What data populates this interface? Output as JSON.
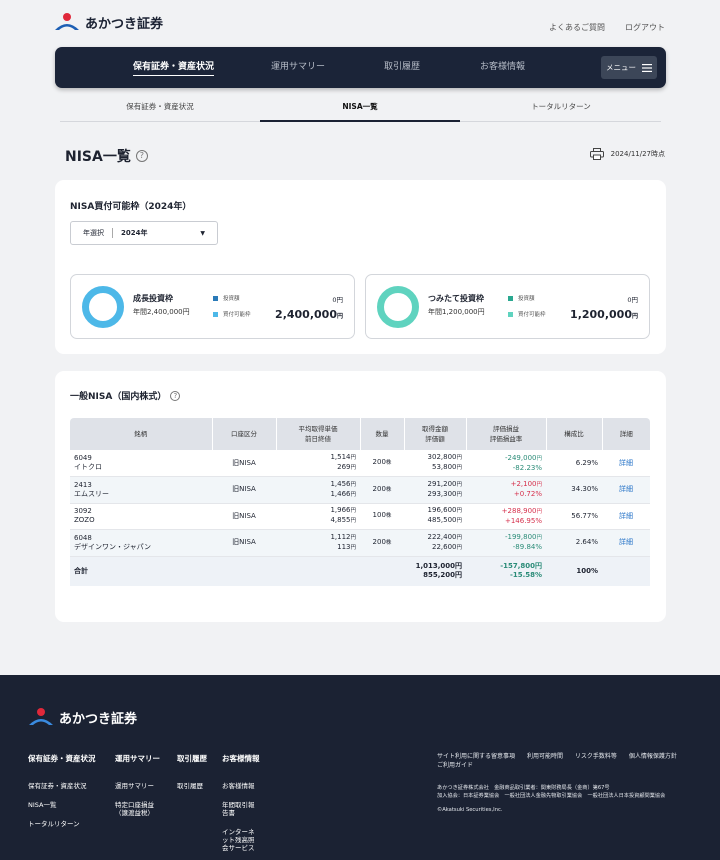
{
  "brand": {
    "name": "あかつき証券"
  },
  "top_links": [
    "よくあるご質問",
    "ログアウト"
  ],
  "nav": {
    "items": [
      "保有証券・資産状況",
      "運用サマリー",
      "取引履歴",
      "お客様情報"
    ],
    "menu_label": "メニュー"
  },
  "subtabs": [
    "保有証券・資産状況",
    "NISA一覧",
    "トータルリターン"
  ],
  "page": {
    "title": "NISA一覧",
    "date": "2024/11/27時点"
  },
  "limits": {
    "title": "NISA買付可能枠（2024年）",
    "year_label": "年選択",
    "year_value": "2024年",
    "legend_invested": "投資額",
    "legend_available": "買付可能枠",
    "boxes": [
      {
        "name": "成長投資枠",
        "annual": "年間2,400,000円",
        "invested": "0",
        "available": "2,400,000",
        "color": "#4db8e8",
        "unit": "円"
      },
      {
        "name": "つみたて投資枠",
        "annual": "年間1,200,000円",
        "invested": "0",
        "available": "1,200,000",
        "color": "#5fd3bf",
        "unit": "円"
      }
    ]
  },
  "holdings": {
    "title": "一般NISA（国内株式）",
    "columns": {
      "name": "銘柄",
      "account": "口座区分",
      "avg1": "平均取得単価",
      "avg2": "前日終値",
      "qty": "数量",
      "amt1": "取得金額",
      "amt2": "評価額",
      "pl1": "評価損益",
      "pl2": "評価損益率",
      "ratio": "構成比",
      "detail": "詳細"
    },
    "rows": [
      {
        "code": "6049",
        "name": "イトクロ",
        "account": "旧NISA",
        "avg": "1,514",
        "close": "269",
        "qty": "200",
        "cost": "302,800",
        "value": "53,800",
        "pl": "-249,000",
        "pl_rate": "-82.23%",
        "ratio": "6.29%",
        "detail": "詳細",
        "sign": "neg"
      },
      {
        "code": "2413",
        "name": "エムスリー",
        "account": "旧NISA",
        "avg": "1,456",
        "close": "1,466",
        "qty": "200",
        "cost": "291,200",
        "value": "293,300",
        "pl": "+2,100",
        "pl_rate": "+0.72%",
        "ratio": "34.30%",
        "detail": "詳細",
        "sign": "pos"
      },
      {
        "code": "3092",
        "name": "ZOZO",
        "account": "旧NISA",
        "avg": "1,966",
        "close": "4,855",
        "qty": "100",
        "cost": "196,600",
        "value": "485,500",
        "pl": "+288,900",
        "pl_rate": "+146.95%",
        "ratio": "56.77%",
        "detail": "詳細",
        "sign": "pos"
      },
      {
        "code": "6048",
        "name": "デザインワン・ジャパン",
        "account": "旧NISA",
        "avg": "1,112",
        "close": "113",
        "qty": "200",
        "cost": "222,400",
        "value": "22,600",
        "pl": "-199,800",
        "pl_rate": "-89.84%",
        "ratio": "2.64%",
        "detail": "詳細",
        "sign": "neg"
      }
    ],
    "total": {
      "label": "合計",
      "cost": "1,013,000円",
      "value": "855,200円",
      "pl": "-157,800円",
      "pl_rate": "-15.58%",
      "ratio": "100%"
    },
    "yen": "円",
    "share_unit": "株"
  },
  "footer": {
    "cols": [
      {
        "head": "保有証券・資産状況",
        "items": [
          "保有証券・資産状況",
          "NISA一覧",
          "トータルリターン"
        ]
      },
      {
        "head": "運用サマリー",
        "items": [
          "運用サマリー",
          "特定口座損益\n（譲渡益税）"
        ]
      },
      {
        "head": "取引履歴",
        "items": [
          "取引履歴"
        ]
      },
      {
        "head": "お客様情報",
        "items": [
          "お客様情報",
          "年間取引報告書",
          "インターネット残高照会サービス"
        ]
      }
    ],
    "links": [
      "サイト利用に関する留意事項",
      "利用可能時間",
      "リスク手数料等",
      "個人情報保護方針",
      "ご利用ガイド"
    ],
    "corp1": "あかつき証券株式会社　金融商品取引業者：関東財務局長（金商）第67号",
    "corp2": "加入協会：日本証券業協会　一般社団法人金融先物取引業協会　一般社団法人日本投資顧問業協会",
    "copyright": "©Akatsuki Securities,Inc."
  }
}
